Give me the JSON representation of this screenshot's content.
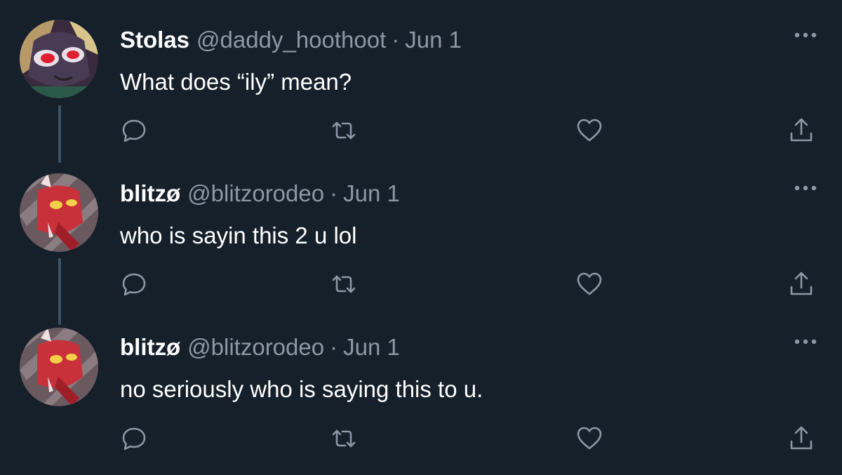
{
  "colors": {
    "background": "#15202b",
    "text_primary": "#ffffff",
    "text_secondary": "#8b98a5",
    "icon": "#8b98a5",
    "thread_line": "#3d5466"
  },
  "icons": {
    "more": "more-options-icon",
    "reply": "reply-icon",
    "retweet": "retweet-icon",
    "like": "like-icon",
    "share": "share-icon"
  },
  "tweets": [
    {
      "display_name": "Stolas",
      "handle": "@daddy_hoothoot",
      "separator": "·",
      "date": "Jun 1",
      "text": "What does “ily” mean?"
    },
    {
      "display_name": "blitzø",
      "handle": "@blitzorodeo",
      "separator": "·",
      "date": "Jun 1",
      "text": "who is sayin this 2 u lol"
    },
    {
      "display_name": "blitzø",
      "handle": "@blitzorodeo",
      "separator": "·",
      "date": "Jun 1",
      "text": "no seriously who is saying this to u."
    }
  ]
}
